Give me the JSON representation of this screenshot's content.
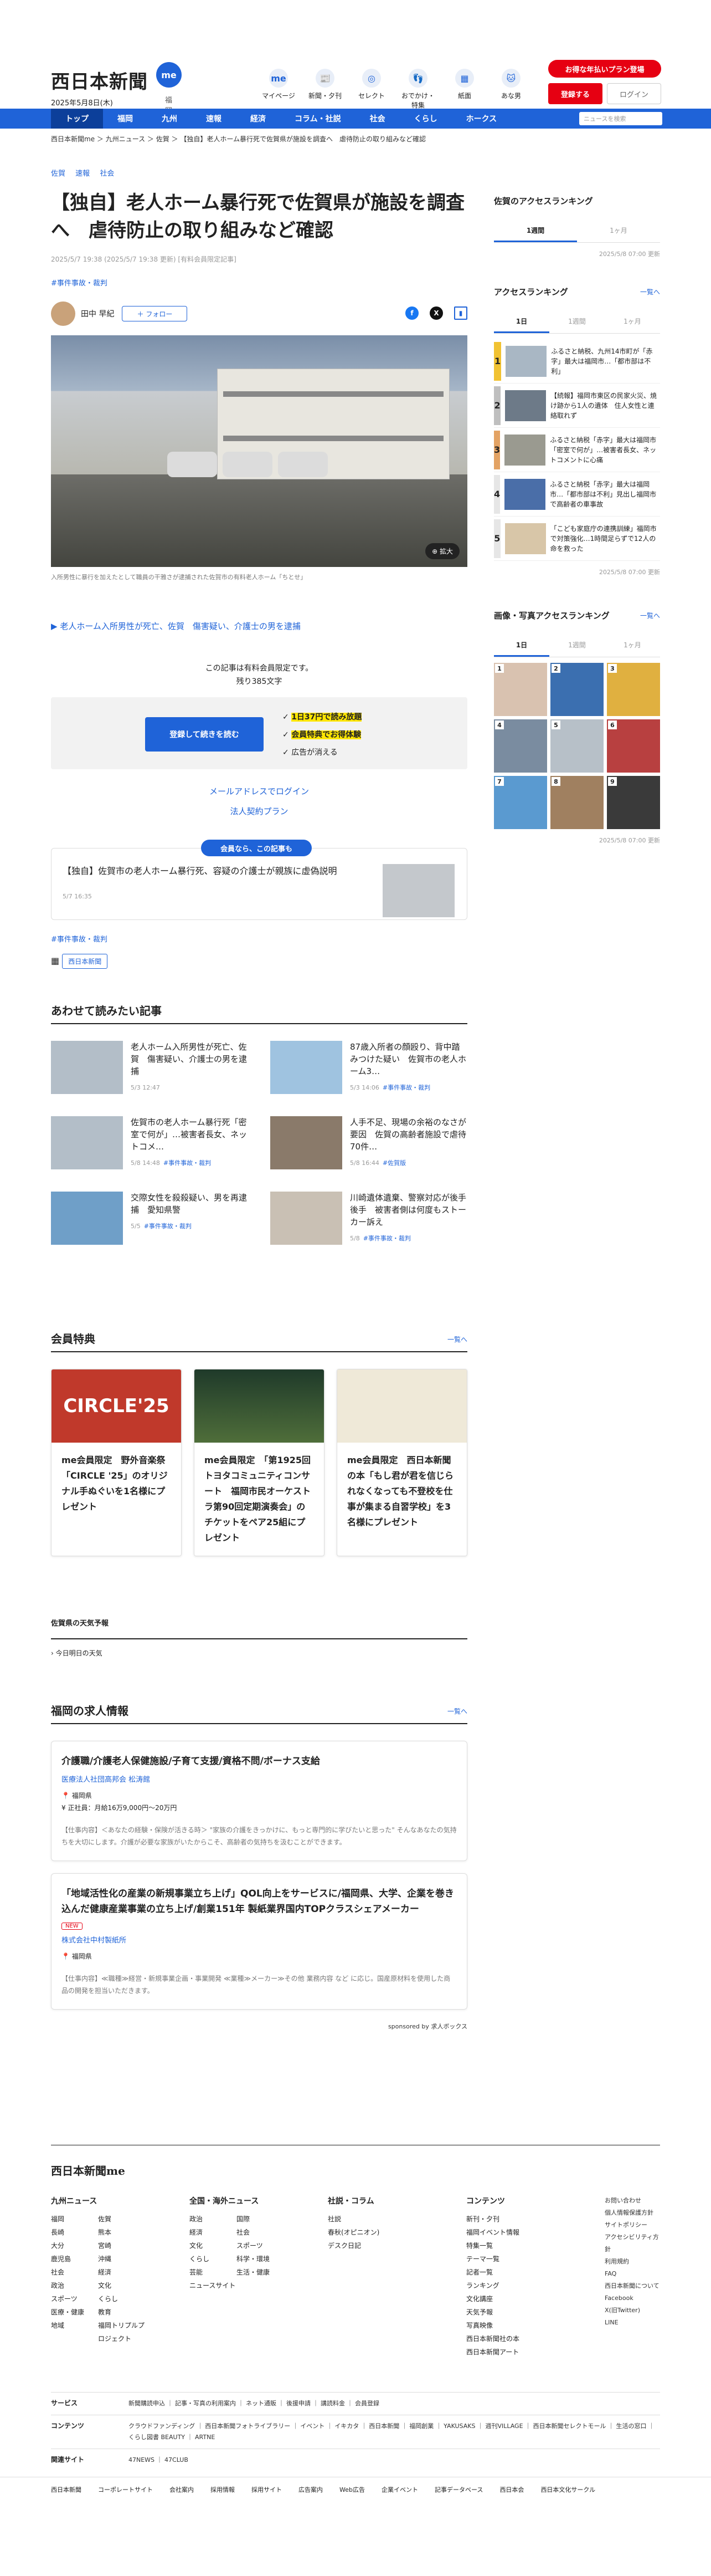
{
  "header": {
    "logo": "西日本新聞",
    "logo_badge": "me",
    "date": "2025年5月8日(木)",
    "city": "福岡",
    "icons": [
      {
        "label": "マイページ",
        "icon": "me"
      },
      {
        "label": "新聞・夕刊",
        "icon": "📰"
      },
      {
        "label": "セレクト",
        "icon": "◎"
      },
      {
        "label": "おでかけ・特集",
        "icon": "👣"
      },
      {
        "label": "紙面",
        "icon": "▦"
      },
      {
        "label": "あな男",
        "icon": "🐱"
      }
    ],
    "promo": "お得な年払いプラン登場",
    "register": "登録する",
    "login": "ログイン"
  },
  "nav": {
    "items": [
      "トップ",
      "福岡",
      "九州",
      "速報",
      "経済",
      "コラム・社説",
      "社会",
      "くらし",
      "ホークス"
    ],
    "search_placeholder": "ニュースを検索"
  },
  "breadcrumb": "西日本新聞me ＞ 九州ニュース ＞ 佐賀 ＞ 【独自】老人ホーム暴行死で佐賀県が施設を調査へ　虐待防止の取り組みなど確認",
  "article": {
    "tags": [
      "佐賀",
      "速報",
      "社会"
    ],
    "title": "【独自】老人ホーム暴行死で佐賀県が施設を調査へ　虐待防止の取り組みなど確認",
    "date": "2025/5/7 19:38 (2025/5/7 19:38 更新) [有料会員限定記事]",
    "category": "#事件事故・裁判",
    "author": "田中 早紀",
    "follow": "＋ フォロー",
    "zoom": "拡大",
    "caption": "入所男性に暴行を加えたとして職員の干雅さが逮捕された佐賀市の有料老人ホーム「ちとせ」",
    "related_link": "老人ホーム入所男性が死亡、佐賀　傷害疑い、介護士の男を逮捕",
    "paywall_text": "この記事は有料会員限定です。",
    "paywall_remaining": "残り385文字",
    "paywall_button": "登録して続きを読む",
    "paywall_benefits": [
      "1日37円で読み放題",
      "会員特典でお得体験",
      "広告が消える"
    ],
    "paywall_links": [
      "メールアドレスでログイン",
      "法人契約プラン"
    ],
    "rec_pill": "会員なら、この記事も",
    "rec_title": "【独自】佐賀市の老人ホーム暴行死、容疑の介護士が親族に虚偽説明",
    "rec_date": "5/7 16:35",
    "category2": "#事件事故・裁判",
    "source": "西日本新聞"
  },
  "related": {
    "title": "あわせて読みたい記事",
    "items": [
      {
        "title": "老人ホーム入所男性が死亡、佐賀　傷害疑い、介護士の男を逮捕",
        "meta": "5/3 12:47"
      },
      {
        "title": "87歳入所者の顔殴り、背中踏みつけた疑い　佐賀市の老人ホーム3…",
        "meta": "5/3 14:06",
        "cat": "#事件事故・裁判"
      },
      {
        "title": "佐賀市の老人ホーム暴行死「密室で何が」…被害者長女、ネットコメ…",
        "meta": "5/8 14:48",
        "cat": "#事件事故・裁判"
      },
      {
        "title": "人手不足、現場の余裕のなさが要因　佐賀の高齢者施設で虐待70件…",
        "meta": "5/8 16:44",
        "cat": "#佐賀版"
      },
      {
        "title": "交際女性を殺殺疑い、男を再逮捕　愛知県警",
        "meta": "5/5",
        "cat": "#事件事故・裁判"
      },
      {
        "title": "川崎遺体遺棄、警察対応が後手後手　被害者側は何度もストーカー訴え",
        "meta": "5/8",
        "cat": "#事件事故・裁判"
      }
    ]
  },
  "benefits": {
    "title": "会員特典",
    "more": "一覧へ",
    "cards": [
      {
        "title": "me会員限定　野外音楽祭「CIRCLE '25」のオリジナル手ぬぐいを1名様にプレゼント",
        "img": "CIRCLE'25"
      },
      {
        "title": "me会員限定　「第1925回トヨタコミュニティコンサート　福岡市民オーケストラ第90回定期演奏会」のチケットをペア25組にプレゼント"
      },
      {
        "title": "me会員限定　西日本新聞の本「もし君が君を信じられなくなっても不登校を仕事が集まる自習学校」を3名様にプレゼント"
      }
    ]
  },
  "weather": {
    "title": "佐賀県の天気予報",
    "link": "今日明日の天気"
  },
  "jobs": {
    "title": "福岡の求人情報",
    "more": "一覧へ",
    "items": [
      {
        "title": "介護職/介護老人保健施設/子育て支援/資格不問/ボーナス支給",
        "company": "医療法人社団高邦会 松涛館",
        "loc": "福岡県",
        "pay": "正社員：月給16万9,000円〜20万円",
        "desc": "【仕事内容】＜あなたの経験・保険が活きる時＞ \"家族の介護をきっかけに、もっと専門的に学びたいと思った\" そんなあなたの気持ちを大切にします。介護が必要な家族がいたからこそ、高齢者の気持ちを汲むことができます。"
      },
      {
        "title": "「地域活性化の産業の新規事業立ち上げ」QOL向上をサービスに/福岡県、大学、企業を巻き込んだ健康産業事業の立ち上げ/創業151年 製紙業界国内TOPクラスシェアメーカー",
        "company": "株式会社中村製紙所",
        "loc": "福岡県",
        "pay": "",
        "desc": "【仕事内容】≪職種≫経営・新規事業企画・事業開発 ≪業種≫メーカー≫その他 業務内容 など に応じ。国産原材料を使用した商品の開発を担当いただきます。"
      }
    ],
    "sponsor": "sponsored by 求人ボックス"
  },
  "sidebar": {
    "access_title": "佐賀のアクセスランキング",
    "access_tabs": [
      "1週間",
      "1ヶ月"
    ],
    "access_updated": "2025/5/8 07:00 更新",
    "rank_title": "アクセスランキング",
    "rank_more": "一覧へ",
    "rank_tabs": [
      "1日",
      "1週間",
      "1ヶ月"
    ],
    "ranks": [
      "ふるさと納税、九州14市町が「赤字」最大は福岡市…「都市部は不利」",
      "【続報】福岡市東区の民家火災、焼け跡から1人の遺体　住人女性と連絡取れず",
      "ふるさと納税「赤字」最大は福岡市　「密室で何が」…被害者長女、ネットコメントに心痛",
      "ふるさと納税「赤字」最大は福岡市…「都市部は不利」見出し福岡市で高齢者の車事故",
      "「こども家庭庁の連携訓練」福岡市で対策強化…1時間足らずで12人の命を救った"
    ],
    "rank_updated": "2025/5/8 07:00 更新",
    "photo_title": "画像・写真アクセスランキング",
    "photo_more": "一覧へ",
    "photo_tabs": [
      "1日",
      "1週間",
      "1ヶ月"
    ],
    "photo_updated": "2025/5/8 07:00 更新"
  },
  "footer": {
    "logo": "西日本新聞me",
    "cols": [
      {
        "title": "九州ニュース",
        "items": [
          "福岡",
          "佐賀",
          "長崎",
          "熊本",
          "大分",
          "宮崎",
          "鹿児島",
          "沖縄",
          "社会",
          "経済",
          "政治",
          "文化",
          "スポーツ",
          "くらし",
          "医療・健康",
          "教育",
          "地域",
          "福岡トリプルプロジェクト"
        ]
      },
      {
        "title": "全国・海外ニュース",
        "items": [
          "政治",
          "国際",
          "経済",
          "社会",
          "文化",
          "スポーツ",
          "くらし",
          "科学・環境",
          "芸能",
          "生活・健康",
          "ニュースサイト"
        ]
      },
      {
        "title": "社説・コラム",
        "items": [
          "社説",
          "春秋(オピニオン)",
          "デスク日記"
        ]
      },
      {
        "title": "コンテンツ",
        "items": [
          "新刊・夕刊",
          "福岡イベント情報",
          "特集一覧",
          "テーマ一覧",
          "記者一覧",
          "ランキング",
          "文化講座",
          "天気予報",
          "写真映像",
          "西日本新聞社の本",
          "西日本新聞アート"
        ]
      }
    ],
    "side_links": [
      "お問い合わせ",
      "個人情報保護方針",
      "サイトポリシー",
      "アクセシビリティ方針",
      "利用規約",
      "FAQ",
      "西日本新聞について",
      "Facebook",
      "X(旧Twitter)",
      "LINE"
    ],
    "services": "新聞購読申込 ｜ 記事・写真の利用案内 ｜ ネット通販 ｜ 後援申請 ｜ 講読料金 ｜ 会員登録",
    "contents": "クラウドファンディング ｜ 西日本新聞フォトライブラリー ｜ イベント ｜ イキカタ ｜ 西日本新聞 ｜ 福岡創業 ｜ YAKUSAKS ｜ 週刊VILLAGE ｜ 西日本新聞セレクトモール ｜ 生活の窓口 ｜ くらし図書 BEAUTY ｜ ARTNE",
    "related": "47NEWS ｜ 47CLUB",
    "bottom": [
      "西日本新聞",
      "コーポレートサイト",
      "会社案内",
      "採用情報",
      "採用サイト",
      "広告案内",
      "Web広告",
      "企業イベント",
      "記事データベース",
      "西日本会",
      "西日本文化サークル"
    ]
  }
}
